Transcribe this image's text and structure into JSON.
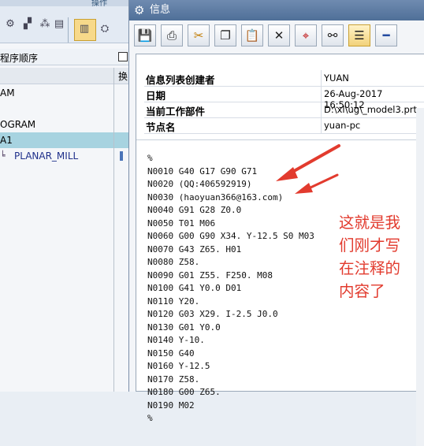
{
  "background": {
    "menu_label": "操作",
    "header_label": "程序顺序",
    "column2_label": "换",
    "tree_rows": [
      {
        "text": "AM",
        "selected": false
      },
      {
        "text": "",
        "selected": false
      },
      {
        "text": "OGRAM",
        "selected": false
      },
      {
        "text": "A1",
        "selected": true
      },
      {
        "text": "PLANAR_MILL",
        "selected": false
      }
    ]
  },
  "dialog": {
    "title": "信息",
    "toolbar_icons": [
      "save-icon",
      "print-icon",
      "cut-icon",
      "copy-icon",
      "paste-icon",
      "delete-icon",
      "find-icon",
      "binoculars-icon",
      "text-icon",
      "minus-icon"
    ],
    "info": [
      {
        "key": "信息列表创建者",
        "value": "YUAN"
      },
      {
        "key": "日期",
        "value": "26-Aug-2017 16:50:12"
      },
      {
        "key": "当前工作部件",
        "value": "D:\\xl\\ug\\_model3.prt"
      },
      {
        "key": "节点名",
        "value": "yuan-pc"
      }
    ],
    "code_lines": [
      "%",
      "N0010 G40 G17 G90 G71",
      "N0020 (QQ:406592919)",
      "N0030 (haoyuan366@163.com)",
      "N0040 G91 G28 Z0.0",
      "N0050 T01 M06",
      "N0060 G00 G90 X34. Y-12.5 S0 M03",
      "N0070 G43 Z65. H01",
      "N0080 Z58.",
      "N0090 G01 Z55. F250. M08",
      "N0100 G41 Y0.0 D01",
      "N0110 Y20.",
      "N0120 G03 X29. I-2.5 J0.0",
      "N0130 G01 Y0.0",
      "N0140 Y-10.",
      "N0150 G40",
      "N0160 Y-12.5",
      "N0170 Z58.",
      "N0180 G00 Z65.",
      "N0190 M02",
      "%"
    ]
  },
  "annotation": {
    "lines": [
      "这就是我",
      "们刚才写",
      "在注释的",
      "内容了"
    ],
    "color": "#e23b2e"
  }
}
